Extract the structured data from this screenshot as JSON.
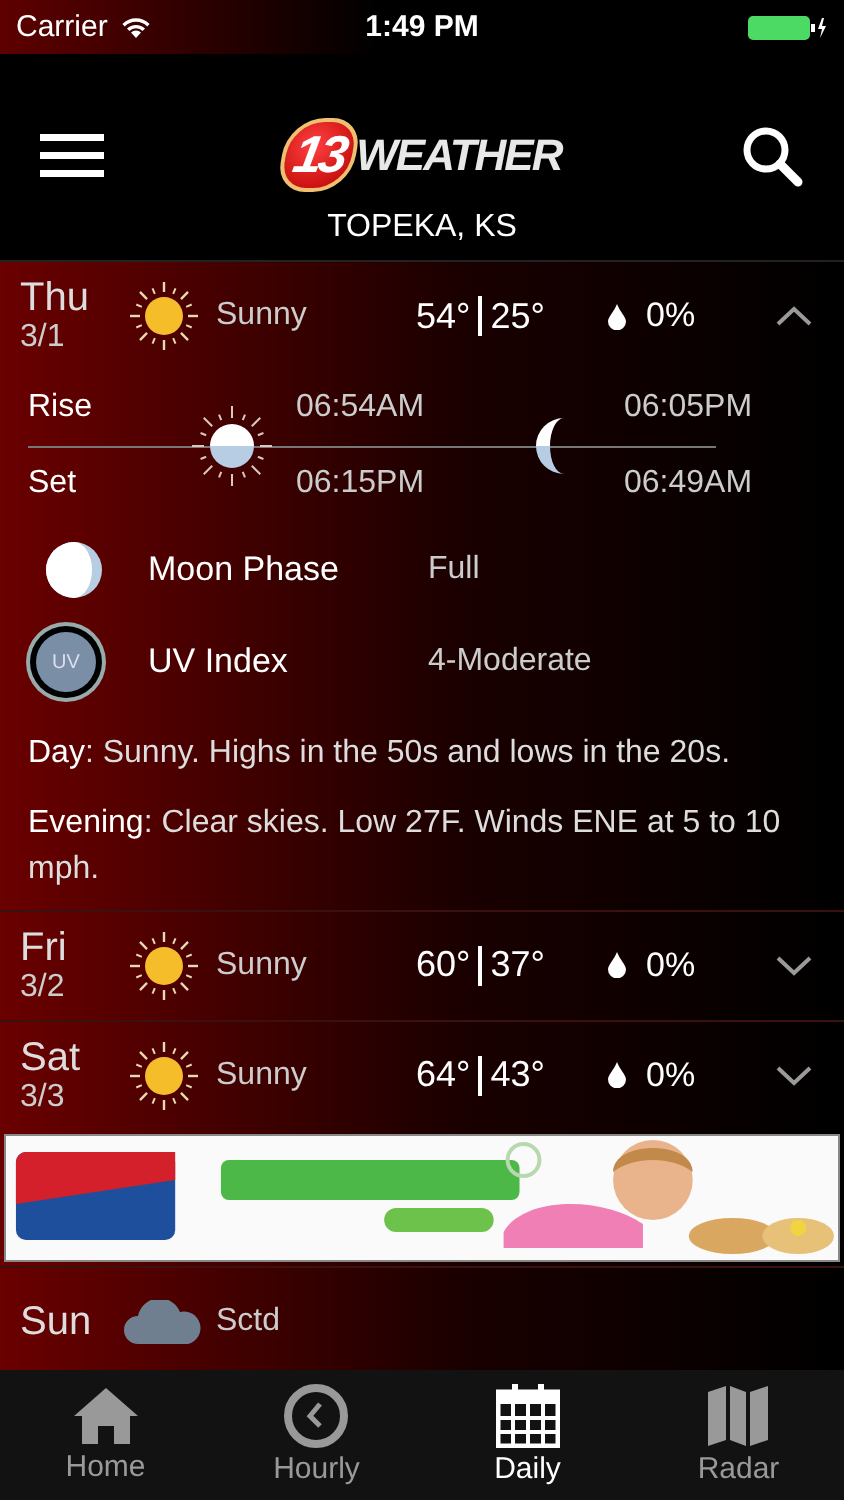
{
  "status_bar": {
    "carrier": "Carrier",
    "time": "1:49 PM"
  },
  "header": {
    "logo": {
      "number": "13",
      "word": "WEATHER"
    },
    "location": "TOPEKA, KS"
  },
  "rows": [
    {
      "kind": "sunny",
      "day": "Thu",
      "date": "3/1",
      "condition": "Sunny",
      "high": "54°",
      "low": "25°",
      "precip": "0%",
      "expanded": true,
      "details": {
        "rise_label": "Rise",
        "set_label": "Set",
        "sunrise": "06:54AM",
        "sunset": "06:15PM",
        "moonrise": "06:05PM",
        "moonset": "06:49AM",
        "moon_phase": {
          "label": "Moon Phase",
          "value": "Full"
        },
        "uv": {
          "badge": "UV",
          "label": "UV Index",
          "value": "4-Moderate"
        },
        "forecasts": [
          "**Day**: Sunny. Highs in the 50s and lows in the 20s.",
          "**Evening**: Clear skies. Low 27F. Winds ENE at 5 to 10 mph."
        ]
      }
    },
    {
      "kind": "sunny",
      "day": "Fri",
      "date": "3/2",
      "condition": "Sunny",
      "high": "60°",
      "low": "37°",
      "precip": "0%",
      "expanded": false
    },
    {
      "kind": "sunny",
      "day": "Sat",
      "date": "3/3",
      "condition": "Sunny",
      "high": "64°",
      "low": "43°",
      "precip": "0%",
      "expanded": false
    },
    {
      "kind": "ad"
    },
    {
      "kind": "cloudy",
      "day": "Sun",
      "condition": "Sctd"
    }
  ],
  "tabs": [
    {
      "label": "Home",
      "selected": false
    },
    {
      "label": "Hourly",
      "selected": false
    },
    {
      "label": "Daily",
      "selected": true
    },
    {
      "label": "Radar",
      "selected": false
    }
  ]
}
